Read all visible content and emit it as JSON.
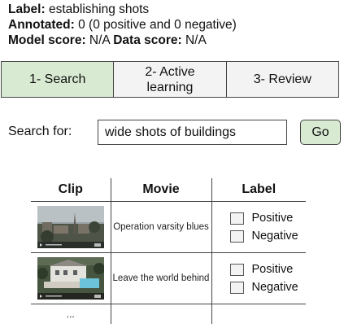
{
  "info": {
    "label_key": "Label:",
    "label_value": " establishing shots",
    "annotated_key": "Annotated:",
    "annotated_value": " 0 (0 positive and 0 negative)",
    "model_score_key": "Model score:",
    "model_score_value": " N/A ",
    "data_score_key": "Data score:",
    "data_score_value": " N/A"
  },
  "tabs": [
    {
      "label": "1- Search",
      "active": true
    },
    {
      "label": "2- Active\nlearning",
      "active": false
    },
    {
      "label": "3- Review",
      "active": false
    }
  ],
  "search": {
    "label": "Search for:",
    "value": "wide shots of buildings",
    "go_label": "Go"
  },
  "table": {
    "headers": {
      "clip": "Clip",
      "movie": "Movie",
      "label": "Label"
    },
    "rows": [
      {
        "movie": "Operation varsity blues",
        "positive_label": "Positive",
        "negative_label": "Negative",
        "positive_checked": false,
        "negative_checked": false
      },
      {
        "movie": "Leave the world behind",
        "positive_label": "Positive",
        "negative_label": "Negative",
        "positive_checked": false,
        "negative_checked": false
      }
    ],
    "more": "..."
  },
  "colors": {
    "active_tab": "#d9ead3",
    "inactive_tab": "#f3f3f3",
    "go_button": "#d9ead3",
    "border": "#444444"
  }
}
